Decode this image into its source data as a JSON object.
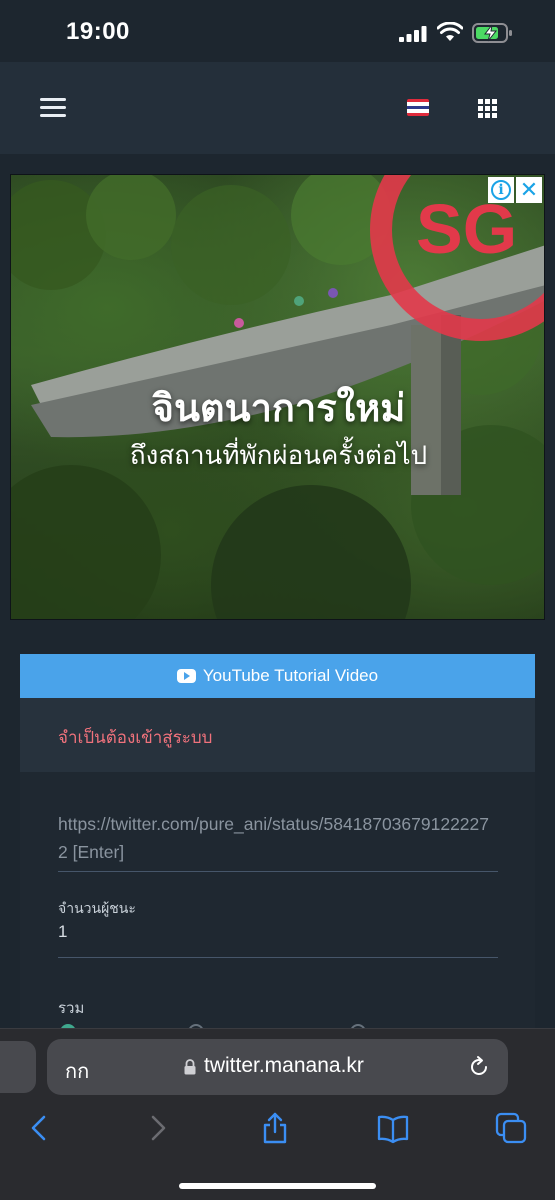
{
  "status_bar": {
    "time": "19:00"
  },
  "navbar": {
    "flag": "thai-flag",
    "icons": [
      "hamburger-menu-icon",
      "apps-grid-icon"
    ]
  },
  "ad": {
    "title": "จินตนาการใหม่",
    "subtitle": "ถึงสถานที่พักผ่อนครั้งต่อไป",
    "logo_text": "SG",
    "info_icon": "i",
    "close_icon": "✕"
  },
  "youtube_button": {
    "label": "YouTube Tutorial Video",
    "icon": "youtube-icon"
  },
  "form": {
    "login_required": "จำเป็นต้องเข้าสู่ระบบ",
    "url_placeholder": "https://twitter.com/pure_ani/status/584187036791222272 [Enter]",
    "winners_label": "จำนวนผู้ชนะ",
    "winners_value": "1",
    "total_label": "รวม"
  },
  "browser": {
    "aa_label": "กก",
    "url": "twitter.manana.kr",
    "toolbar": [
      "back-icon",
      "forward-icon",
      "share-icon",
      "bookmarks-icon",
      "tabs-icon"
    ]
  },
  "colors": {
    "background": "#1d262f",
    "navbar": "#242f3a",
    "accent_blue": "#4aa3ea",
    "error_red": "#f0727c",
    "ios_blue": "#3b8ef3"
  }
}
